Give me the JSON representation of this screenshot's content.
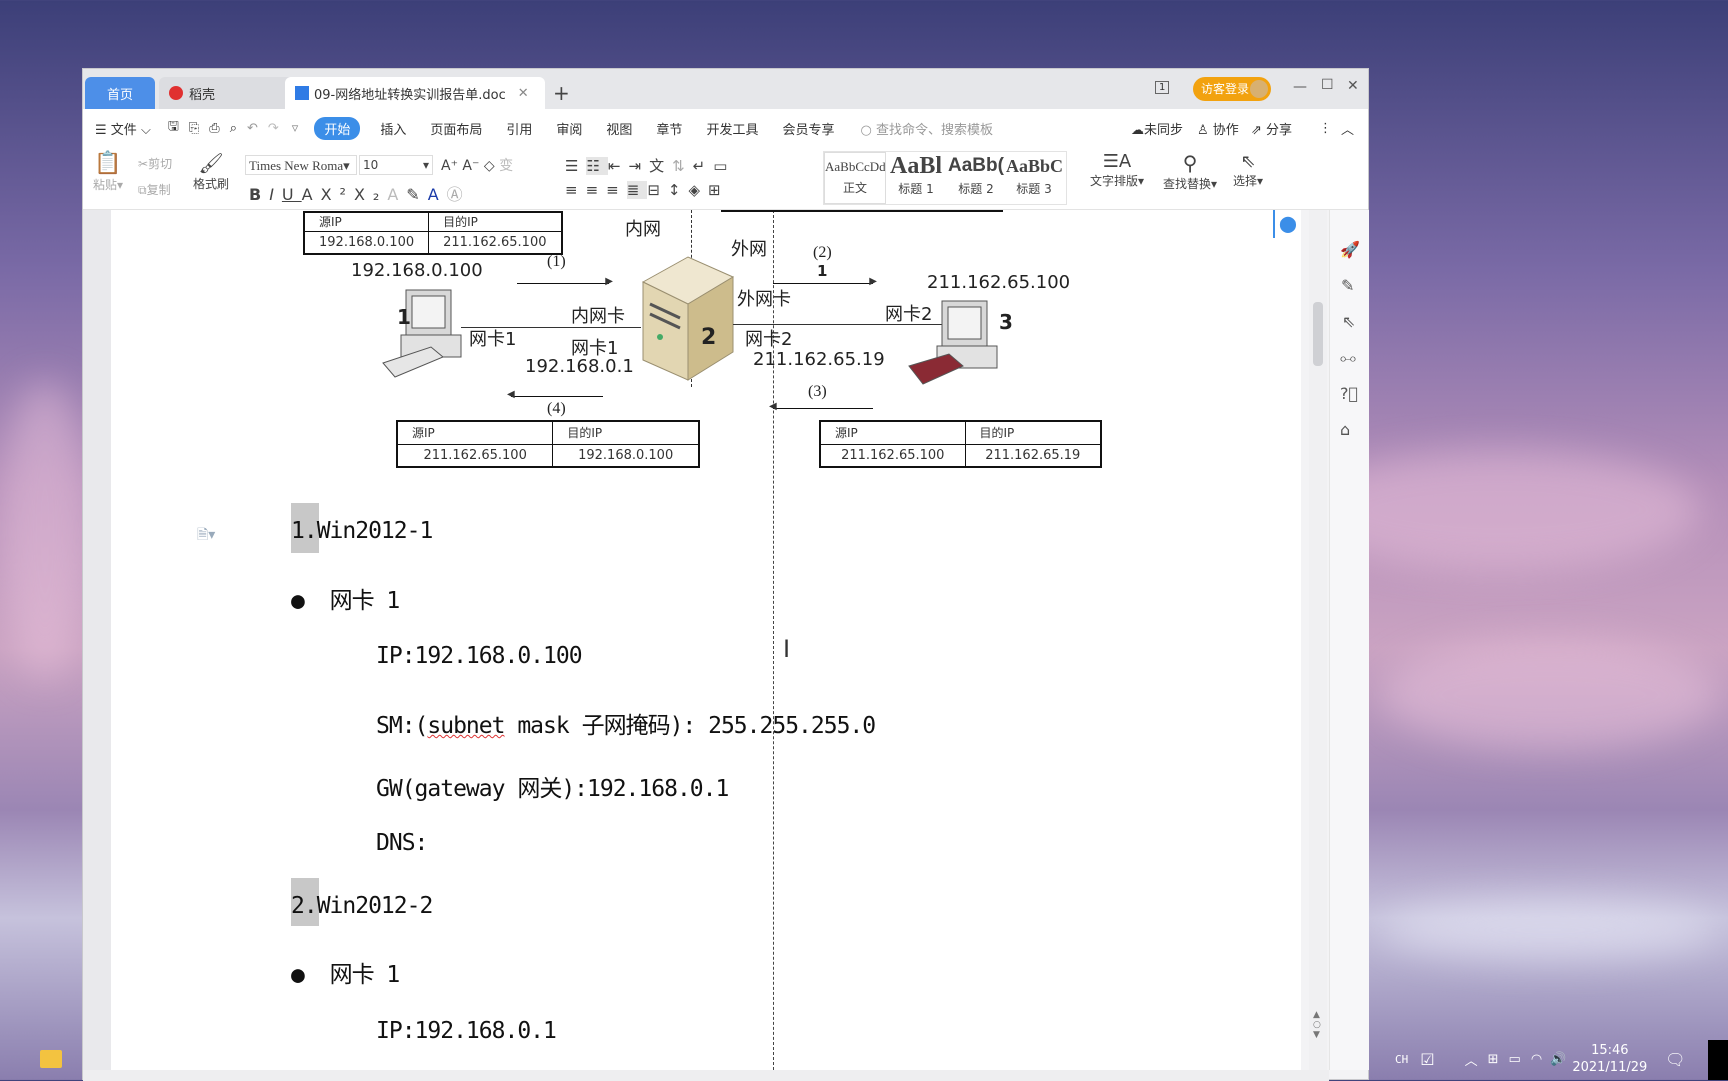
{
  "tabs": [
    {
      "label": "首页",
      "active": false
    },
    {
      "label": "稻壳",
      "active": false
    },
    {
      "label": "09-网络地址转换实训报告单.doc",
      "active": true
    }
  ],
  "titlebar": {
    "guest_login": "访客登录",
    "page_indicator": "1"
  },
  "menu": {
    "file": "文件",
    "items": [
      "开始",
      "插入",
      "页面布局",
      "引用",
      "审阅",
      "视图",
      "章节",
      "开发工具",
      "会员专享"
    ],
    "active": "开始",
    "search_placeholder": "查找命令、搜索模板",
    "sync": "未同步",
    "collab": "协作",
    "share": "分享"
  },
  "toolbar": {
    "paste": "粘贴",
    "cut": "剪切",
    "copy": "复制",
    "format_painter": "格式刷",
    "font_name": "Times New Roma",
    "font_size": "10",
    "styles": [
      {
        "sample": "AaBbCcDd",
        "name": "正文"
      },
      {
        "sample": "AaBl",
        "name": "标题 1"
      },
      {
        "sample": "AaBb(",
        "name": "标题 2"
      },
      {
        "sample": "AaBbC",
        "name": "标题 3"
      }
    ],
    "text_layout": "文字排版",
    "find_replace": "查找替换",
    "select": "选择"
  },
  "diagram": {
    "top_table": {
      "headers": [
        "源IP",
        "目的IP"
      ],
      "row": [
        "192.168.0.100",
        "211.162.65.100"
      ]
    },
    "inner_net": "内网",
    "outer_net": "外网",
    "pc1_ip": "192.168.0.100",
    "step1": "(1)",
    "step2": "(2)",
    "step3": "(3)",
    "step4": "(4)",
    "pc1_num": "1",
    "pc1_nic": "网卡1",
    "inner_nic": "内网卡",
    "server_nic1": "网卡1",
    "server_ip1": "192.168.0.1",
    "server_num": "2",
    "outer_nic": "外网卡",
    "server_nic2": "网卡2",
    "server_ip2": "211.162.65.19",
    "pc3_ip": "211.162.65.100",
    "pc3_nic": "网卡2",
    "pc3_num": "3",
    "cursor_mark": "1",
    "bottom_left_table": {
      "headers": [
        "源IP",
        "目的IP"
      ],
      "row": [
        "211.162.65.100",
        "192.168.0.100"
      ]
    },
    "bottom_right_table": {
      "headers": [
        "源IP",
        "目的IP"
      ],
      "row": [
        "211.162.65.100",
        "211.162.65.19"
      ]
    }
  },
  "body": {
    "h1": "1.Win2012-1",
    "nic1": "网卡 1",
    "ip1": "IP:192.168.0.100",
    "sm_pre": "SM:(",
    "sm_word": "subnet",
    "sm_post": " mask 子网掩码): 255.255.255.0",
    "gw": "GW(gateway 网关):192.168.0.1",
    "dns": "DNS:",
    "h2": "2.Win2012-2",
    "nic2": "网卡 1",
    "ip2": "IP:192.168.0.1"
  },
  "taskbar": {
    "ime": "CH",
    "time": "15:46",
    "date": "2021/11/29"
  },
  "colors": {
    "accent": "#3b8ee8",
    "guest": "#f2a20f"
  }
}
